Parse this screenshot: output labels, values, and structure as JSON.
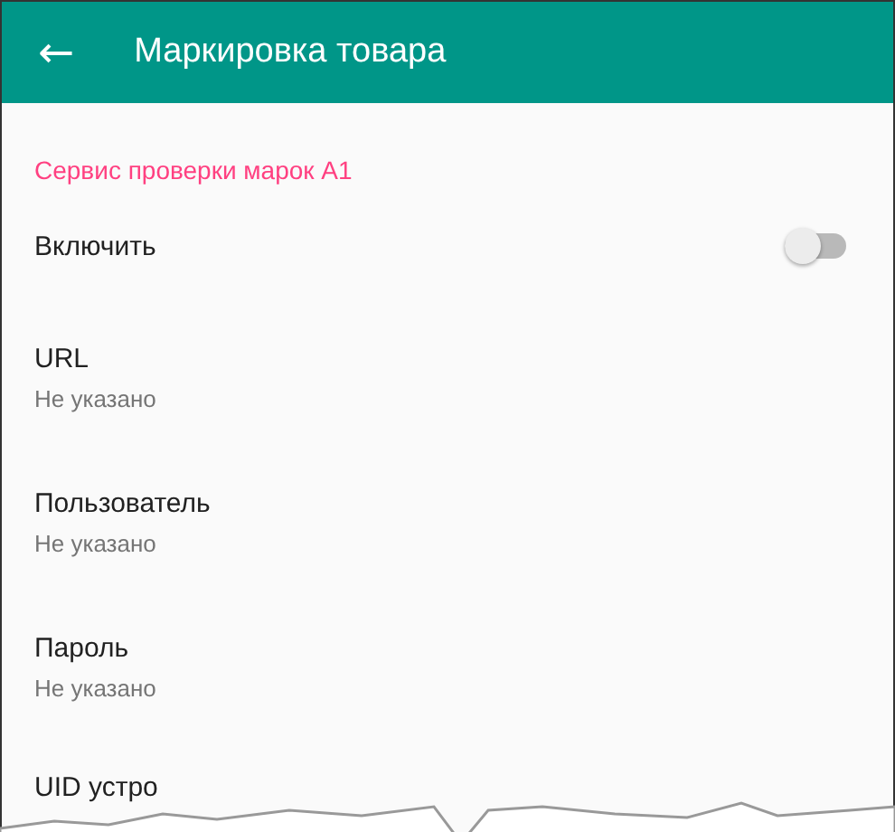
{
  "toolbar": {
    "back_icon": "←",
    "title": "Маркировка товара"
  },
  "section": {
    "title": "Сервис проверки марок А1"
  },
  "items": [
    {
      "kind": "switch",
      "title": "Включить",
      "on": false
    },
    {
      "kind": "text",
      "title": "URL",
      "summary": "Не указано"
    },
    {
      "kind": "text",
      "title": "Пользователь",
      "summary": "Не указано"
    },
    {
      "kind": "text",
      "title": "Пароль",
      "summary": "Не указано"
    },
    {
      "kind": "cut",
      "title": "UID устро"
    }
  ]
}
